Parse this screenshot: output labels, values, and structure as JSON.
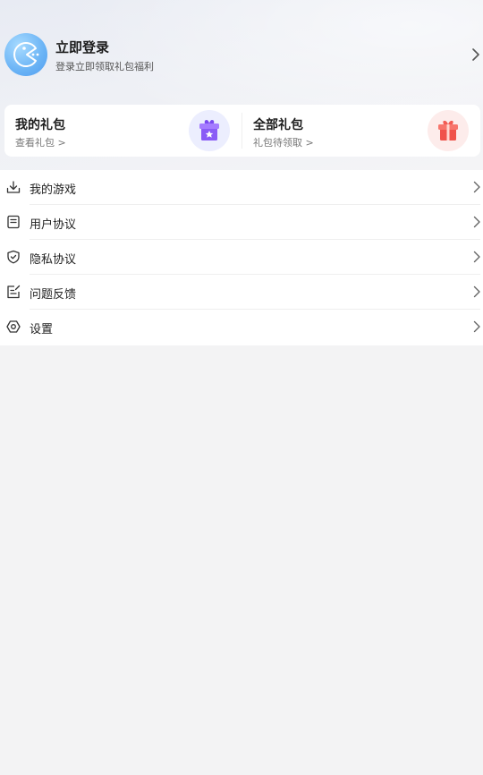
{
  "login": {
    "title": "立即登录",
    "subtitle": "登录立即领取礼包福利"
  },
  "gifts": {
    "mine": {
      "title": "我的礼包",
      "sub": "查看礼包 >"
    },
    "all": {
      "title": "全部礼包",
      "sub": "礼包待领取 >"
    }
  },
  "menu": {
    "items": [
      {
        "label": "我的游戏",
        "icon": "download-icon"
      },
      {
        "label": "用户协议",
        "icon": "document-icon"
      },
      {
        "label": "隐私协议",
        "icon": "shield-icon"
      },
      {
        "label": "问题反馈",
        "icon": "edit-icon"
      },
      {
        "label": "设置",
        "icon": "settings-icon"
      }
    ]
  },
  "colors": {
    "background": "#f3f3f4",
    "avatar": "#6ab3f5",
    "gift_purple": "#7b4bf0",
    "gift_red": "#f25c54"
  }
}
